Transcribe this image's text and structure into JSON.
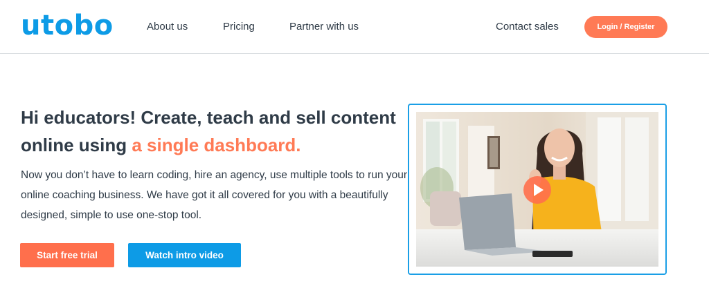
{
  "brand": {
    "logo_text": "utobo",
    "primary_color": "#0d9be6",
    "accent_color": "#ff7a55"
  },
  "nav": {
    "items": [
      "About us",
      "Pricing",
      "Partner with us"
    ],
    "contact_label": "Contact sales",
    "login_label": "Login / Register"
  },
  "hero": {
    "headline_part1": "Hi educators! Create, teach and sell content online using ",
    "headline_accent": "a single dashboard.",
    "description": "Now you don’t have to learn coding, hire an agency, use multiple tools to run your online coaching business. We have got it all covered for you with a beautifully designed, simple to use one-stop tool.",
    "primary_cta": "Start free trial",
    "secondary_cta": "Watch intro video"
  },
  "video": {
    "play_icon": "play-icon"
  }
}
